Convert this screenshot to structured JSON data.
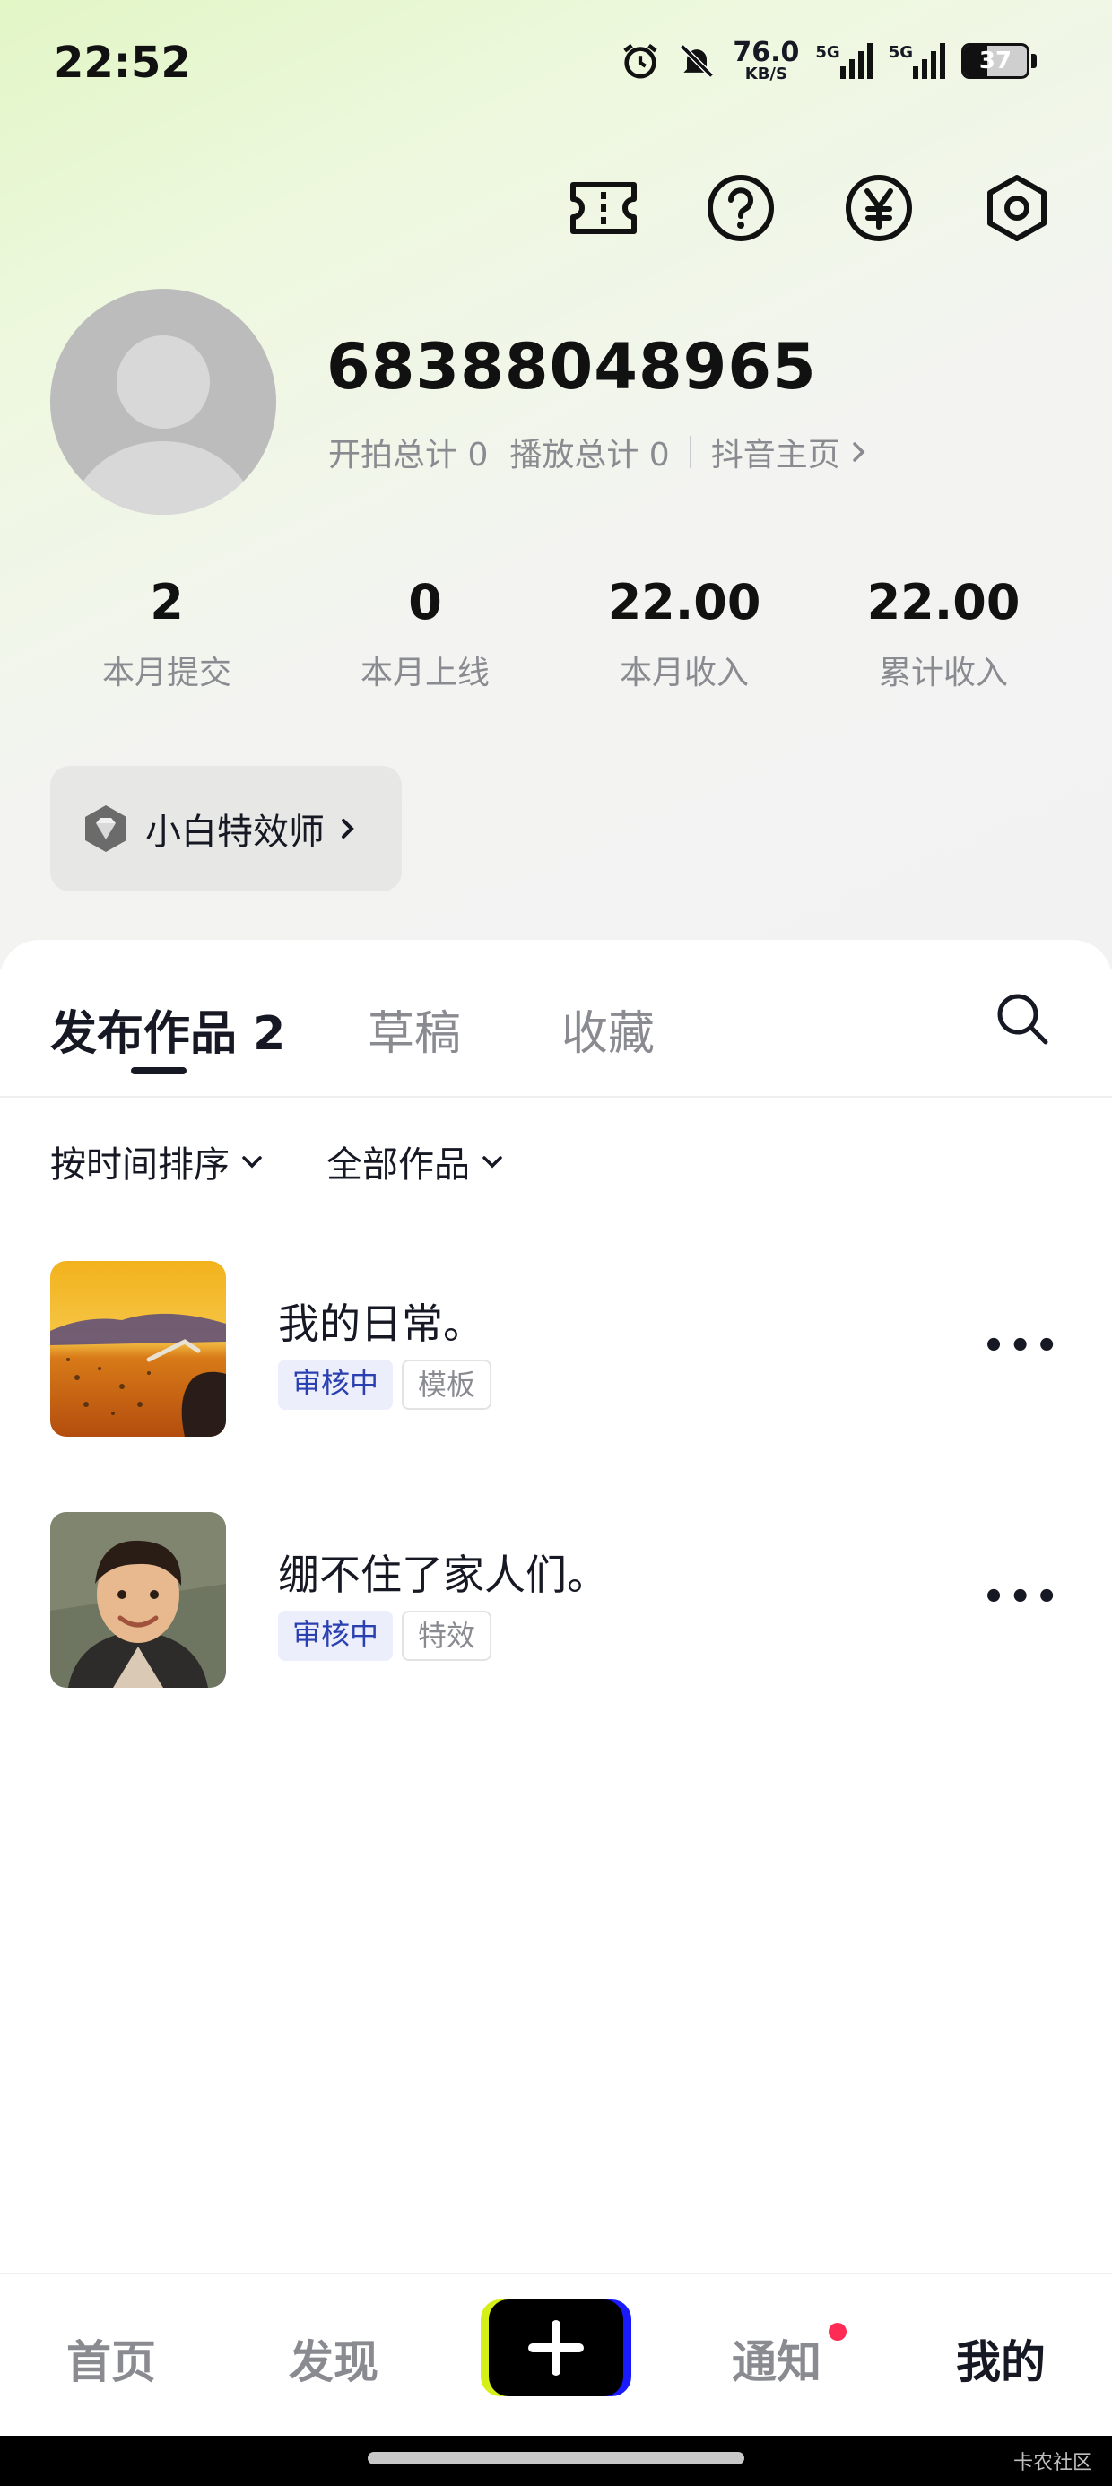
{
  "status_bar": {
    "time": "22:52",
    "net_speed": "76.0",
    "net_unit": "KB/S",
    "sig1": "5G",
    "sig2": "5G",
    "battery": "37",
    "battery_level": 0.37
  },
  "profile": {
    "username": "68388048965",
    "shoot_total": "开拍总计 0",
    "play_total": "播放总计 0",
    "home_link": "抖音主页"
  },
  "stats": [
    {
      "value": "2",
      "label": "本月提交"
    },
    {
      "value": "0",
      "label": "本月上线"
    },
    {
      "value": "22.00",
      "label": "本月收入"
    },
    {
      "value": "22.00",
      "label": "累计收入"
    }
  ],
  "badge": {
    "label": "小白特效师"
  },
  "tabs": {
    "published": "发布作品 2",
    "drafts": "草稿",
    "favorites": "收藏"
  },
  "filters": {
    "sort": "按时间排序",
    "category": "全部作品"
  },
  "works": [
    {
      "title": "我的日常。",
      "status": "审核中",
      "type": "模板"
    },
    {
      "title": "绷不住了家人们。",
      "status": "审核中",
      "type": "特效"
    }
  ],
  "more_glyph": "•••",
  "nav": {
    "home": "首页",
    "discover": "发现",
    "notify": "通知",
    "me": "我的"
  },
  "watermark": "卡农社区",
  "colors": {
    "accent": "#fe2c55",
    "tag_blue": "#2a3fb0",
    "text": "#161823",
    "muted": "#8a8b91"
  }
}
